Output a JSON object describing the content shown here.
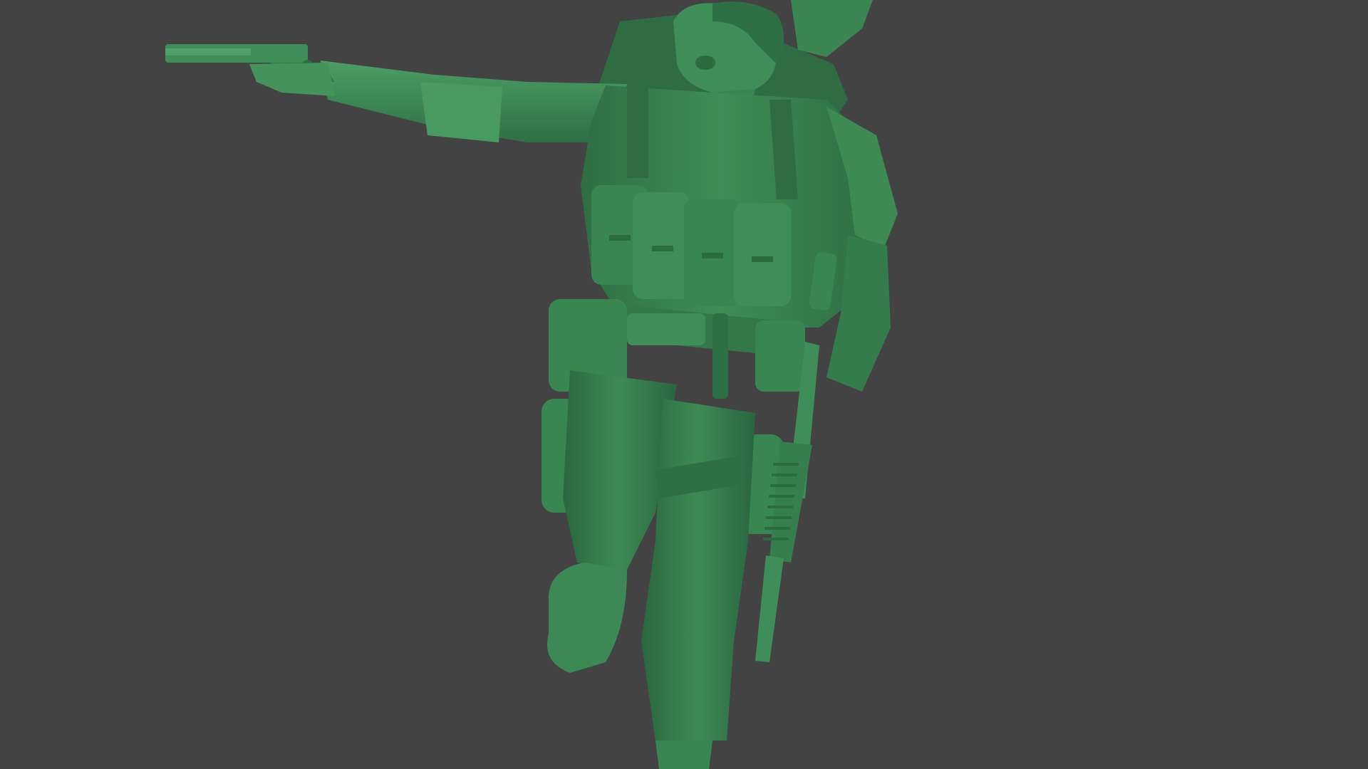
{
  "scene": {
    "background_color": "#434343",
    "model_color": "#3d8a55",
    "model_shadow_color": "#2c6a40",
    "model_highlight_color": "#5aa874",
    "subject": "green-plastic-soldier-sculpt"
  }
}
